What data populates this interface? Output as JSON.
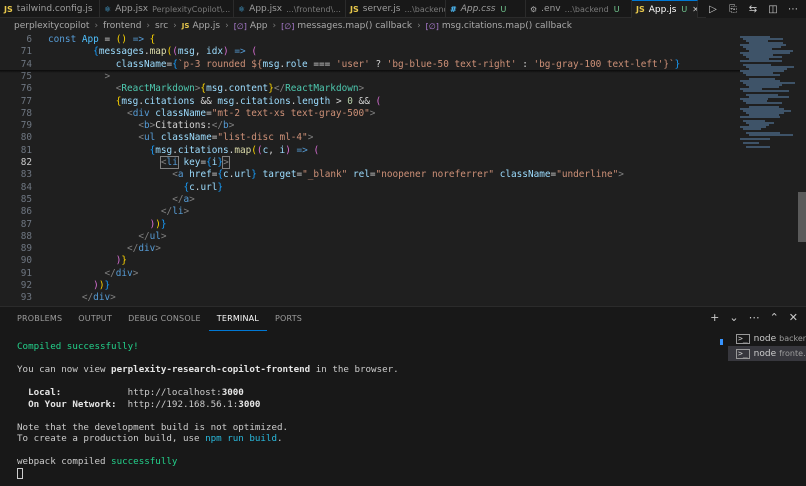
{
  "tabs": [
    {
      "icon": "JS",
      "name": "tailwind.config.js",
      "desc": "",
      "status": "",
      "italic": false,
      "active": false,
      "icolor": "#e8c84b"
    },
    {
      "icon": "⚛",
      "name": "App.jsx",
      "desc": "PerplexityCopilot\\...",
      "status": "",
      "italic": false,
      "active": false,
      "icolor": "#4fc1ff"
    },
    {
      "icon": "⚛",
      "name": "App.jsx",
      "desc": "...\\frontend\\...",
      "status": "U",
      "italic": false,
      "active": false,
      "icolor": "#4fc1ff"
    },
    {
      "icon": "JS",
      "name": "server.js",
      "desc": "...\\backend",
      "status": "U",
      "italic": false,
      "active": false,
      "icolor": "#e8c84b"
    },
    {
      "icon": "#",
      "name": "App.css",
      "desc": "",
      "status": "U",
      "italic": true,
      "active": false,
      "icolor": "#4fc1ff"
    },
    {
      "icon": "⚙",
      "name": ".env",
      "desc": "...\\backend",
      "status": "U",
      "italic": false,
      "active": false,
      "icolor": "#a9a9a9"
    },
    {
      "icon": "JS",
      "name": "App.js",
      "desc": "",
      "status": "U",
      "italic": false,
      "active": true,
      "icolor": "#e8c84b"
    }
  ],
  "tab_close": "✕",
  "breadcrumb": {
    "parts": [
      "perplexitycopilot",
      "frontend",
      "src"
    ],
    "file": "App.js",
    "symbols": [
      "App",
      "messages.map() callback",
      "msg.citations.map() callback"
    ],
    "js_label": "JS",
    "fn_label": "[∅]"
  },
  "code_lines": [
    {
      "num": "6",
      "sticky": true,
      "html": "<span class='k'>const</span> <span class='c'>App</span> = <span class='b1'>()</span> <span class='k'>=&gt;</span> <span class='b1'>{</span>"
    },
    {
      "num": "71",
      "sticky": true,
      "html": "        <span class='b3'>{</span><span class='a'>messages</span>.<span class='f'>map</span><span class='b1'>(</span><span class='b2'>(</span><span class='a'>msg</span>, <span class='a'>idx</span><span class='b2'>)</span> <span class='k'>=&gt;</span> <span class='b2'>(</span>"
    },
    {
      "num": "74",
      "sticky": true,
      "html": "            <span class='a'>className</span>=<span class='b3'>{</span><span class='s'>`p-3 rounded ${</span><span class='a'>msg</span>.<span class='a'>role</span> === <span class='s'>'user'</span> ? <span class='s'>'bg-blue-50 text-right'</span> : <span class='s'>'bg-gray-100 text-left'</span><span class='s'>}`</span><span class='b3'>}</span>"
    },
    {
      "num": "75",
      "sticky": false,
      "html": "          <span class='p'>&gt;</span>"
    },
    {
      "num": "76",
      "sticky": false,
      "html": "            <span class='p'>&lt;</span><span class='t'>ReactMarkdown</span><span class='p'>&gt;</span><span class='b1'>{</span><span class='a'>msg</span>.<span class='a'>content</span><span class='b1'>}</span><span class='p'>&lt;/</span><span class='t'>ReactMarkdown</span><span class='p'>&gt;</span>"
    },
    {
      "num": "77",
      "sticky": false,
      "html": "            <span class='b1'>{</span><span class='a'>msg</span>.<span class='a'>citations</span> &amp;&amp; <span class='a'>msg</span>.<span class='a'>citations</span>.<span class='a'>length</span> &gt; <span class='n'>0</span> &amp;&amp; <span class='b2'>(</span>"
    },
    {
      "num": "78",
      "sticky": false,
      "html": "              <span class='p'>&lt;</span><span class='k'>div</span> <span class='a'>className</span>=<span class='s'>\"mt-2 text-xs text-gray-500\"</span><span class='p'>&gt;</span>"
    },
    {
      "num": "79",
      "sticky": false,
      "html": "                <span class='p'>&lt;</span><span class='k'>b</span><span class='p'>&gt;</span>Citations:<span class='p'>&lt;/</span><span class='k'>b</span><span class='p'>&gt;</span>"
    },
    {
      "num": "80",
      "sticky": false,
      "html": "                <span class='p'>&lt;</span><span class='k'>ul</span> <span class='a'>className</span>=<span class='s'>\"list-disc ml-4\"</span><span class='p'>&gt;</span>"
    },
    {
      "num": "81",
      "sticky": false,
      "html": "                  <span class='b3'>{</span><span class='a'>msg</span>.<span class='a'>citations</span>.<span class='f'>map</span><span class='b1'>(</span><span class='b2'>(</span><span class='a'>c</span>, <span class='a'>i</span><span class='b2'>)</span> <span class='k'>=&gt;</span> <span class='b2'>(</span>"
    },
    {
      "num": "82",
      "sticky": false,
      "html": "                    <span class='lb'><span class='p'>&lt;</span><span class='k'>li</span></span> <span class='a'>key</span>=<span class='b3'>{</span><span class='a'>i</span><span class='b3'>}</span><span class='lb'><span class='p'>&gt;</span></span>"
    },
    {
      "num": "83",
      "sticky": false,
      "html": "                      <span class='p'>&lt;</span><span class='k'>a</span> <span class='a'>href</span>=<span class='b3'>{</span><span class='a'>c</span>.<span class='a'>url</span><span class='b3'>}</span> <span class='a'>target</span>=<span class='s'>\"_blank\"</span> <span class='a'>rel</span>=<span class='s'>\"noopener noreferrer\"</span> <span class='a'>className</span>=<span class='s'>\"underline\"</span><span class='p'>&gt;</span>"
    },
    {
      "num": "84",
      "sticky": false,
      "html": "                        <span class='b3'>{</span><span class='a'>c</span>.<span class='a'>url</span><span class='b3'>}</span>"
    },
    {
      "num": "85",
      "sticky": false,
      "html": "                      <span class='p'>&lt;/</span><span class='k'>a</span><span class='p'>&gt;</span>"
    },
    {
      "num": "86",
      "sticky": false,
      "html": "                    <span class='p'>&lt;/</span><span class='k'>li</span><span class='p'>&gt;</span>"
    },
    {
      "num": "87",
      "sticky": false,
      "html": "                  <span class='b2'>)</span><span class='b1'>)</span><span class='b3'>}</span>"
    },
    {
      "num": "88",
      "sticky": false,
      "html": "                <span class='p'>&lt;/</span><span class='k'>ul</span><span class='p'>&gt;</span>"
    },
    {
      "num": "89",
      "sticky": false,
      "html": "              <span class='p'>&lt;/</span><span class='k'>div</span><span class='p'>&gt;</span>"
    },
    {
      "num": "90",
      "sticky": false,
      "html": "            <span class='b2'>)</span><span class='b1'>}</span>"
    },
    {
      "num": "91",
      "sticky": false,
      "html": "          <span class='p'>&lt;/</span><span class='k'>div</span><span class='p'>&gt;</span>"
    },
    {
      "num": "92",
      "sticky": false,
      "html": "        <span class='b2'>)</span><span class='b1'>)</span><span class='b3'>}</span>"
    },
    {
      "num": "93",
      "sticky": false,
      "html": "      <span class='p'>&lt;/</span><span class='k'>div</span><span class='p'>&gt;</span>"
    }
  ],
  "current_line": "82",
  "panel": {
    "tabs": [
      "PROBLEMS",
      "OUTPUT",
      "DEBUG CONSOLE",
      "TERMINAL",
      "PORTS"
    ],
    "active_tab": "TERMINAL",
    "actions": [
      "+",
      "⌄",
      "⋯",
      "⌃",
      "✕"
    ]
  },
  "terminal": {
    "lines": [
      {
        "html": "<span class='green'>Compiled successfully!</span>"
      },
      {
        "html": ""
      },
      {
        "html": "You can now view <span class='bold'>perplexity-research-copilot-frontend</span> in the browser."
      },
      {
        "html": ""
      },
      {
        "html": "  <span class='bold'>Local:</span>            http://localhost:<span class='bold'>3000</span>"
      },
      {
        "html": "  <span class='bold'>On Your Network:</span>  http://192.168.56.1:<span class='bold'>3000</span>"
      },
      {
        "html": ""
      },
      {
        "html": "Note that the development build is not optimized."
      },
      {
        "html": "To create a production build, use <span class='cyan'>npm run build</span>."
      },
      {
        "html": ""
      },
      {
        "html": "webpack compiled <span class='green'>successfully</span>"
      },
      {
        "html": "<span class='cursor'></span>"
      }
    ],
    "instances": [
      {
        "name": "node",
        "sub": "backend",
        "active": false
      },
      {
        "name": "node",
        "sub": "fronte...",
        "active": true
      }
    ]
  }
}
